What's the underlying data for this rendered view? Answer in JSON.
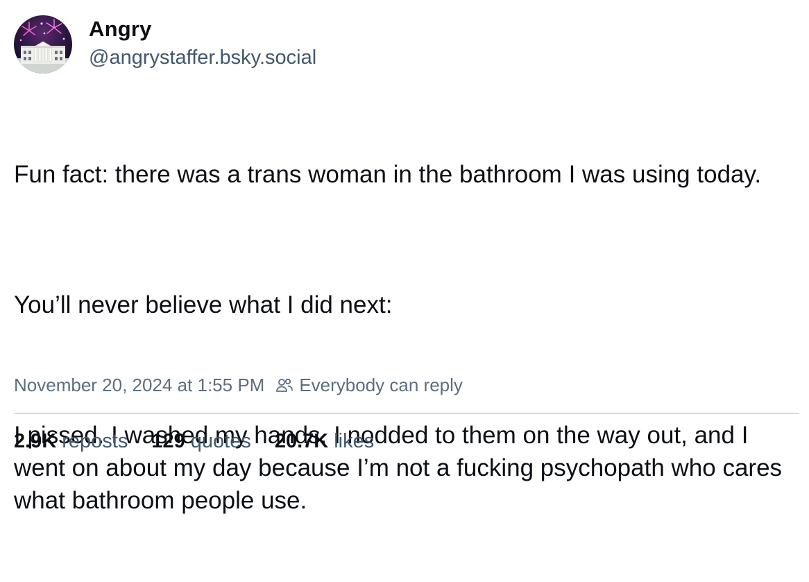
{
  "author": {
    "display_name": "Angry",
    "handle": "@angrystaffer.bsky.social",
    "avatar_icon": "white-house-fireworks-avatar"
  },
  "post": {
    "paragraphs": [
      "Fun fact: there was a trans woman in the bathroom I was using today.",
      "You’ll never believe what I did next:",
      "I pissed. I washed my hands. I nodded to them on the way out, and I went on about my day because I’m not a fucking psychopath who cares what bathroom people use."
    ],
    "timestamp": "November 20, 2024 at 1:55 PM",
    "reply_setting": "Everybody can reply",
    "reply_icon": "people-icon"
  },
  "stats": {
    "reposts_count": "2.9K",
    "reposts_label": "reposts",
    "quotes_count": "129",
    "quotes_label": "quotes",
    "likes_count": "20.7K",
    "likes_label": "likes"
  },
  "colors": {
    "text": "#0b0f14",
    "secondary_text": "#42576c",
    "meta_text": "#5c6e80",
    "divider": "#d4dbe2"
  }
}
